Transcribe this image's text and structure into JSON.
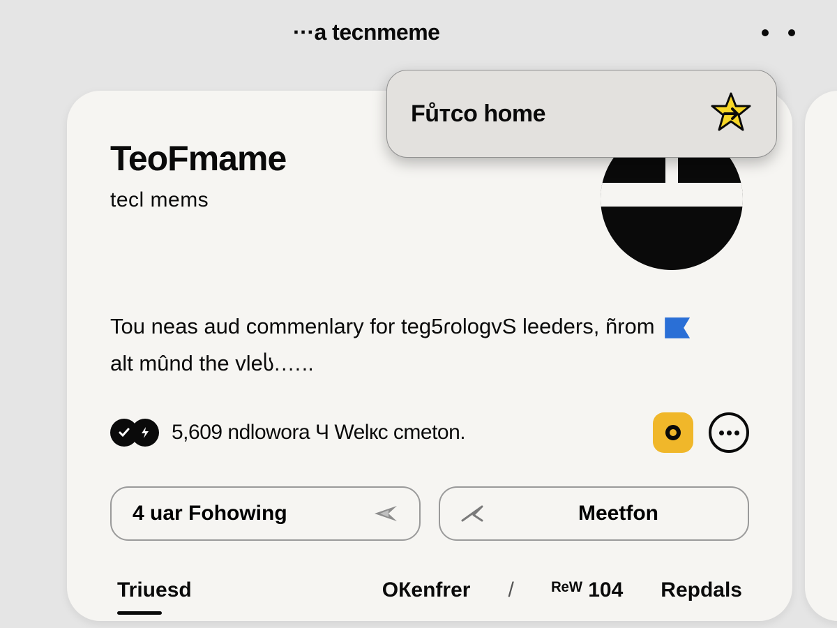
{
  "header": {
    "breadcrumb": "···a tecnmeme"
  },
  "overlay": {
    "label": "Fůтco home"
  },
  "profile": {
    "display_name": "TeoFmame",
    "handle": "tecl mems",
    "bio_line1": "Tou neas aud commenlary for teg5ɾologvS leeders, ñrom",
    "bio_line2": "alt mûnd the vleს.…..",
    "stats_text": "5,609 ndlowora Ч Welкc cmеton."
  },
  "actions": {
    "following_label": "4 uar Fohowing",
    "mention_label": "Meetfon"
  },
  "tabs": {
    "t1": "Triuesd",
    "t2": "OКenfrer",
    "sep": "/",
    "meta": "ᴿᵉᵂ 104",
    "t3": "Repdals"
  }
}
